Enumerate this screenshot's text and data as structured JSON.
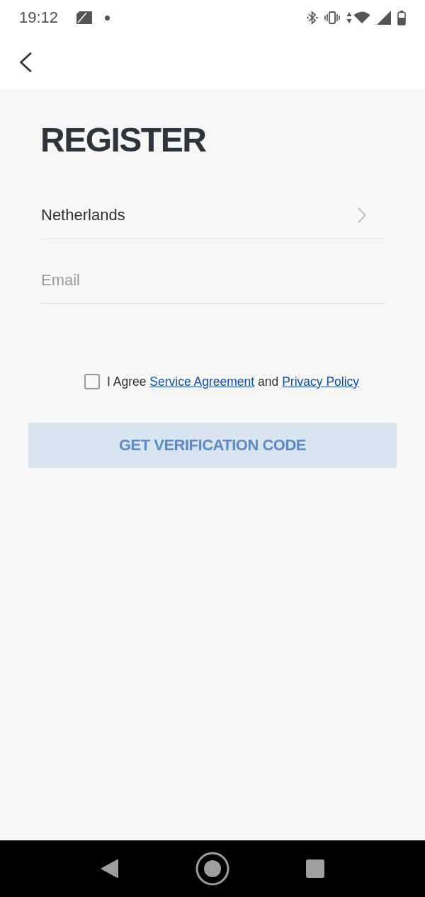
{
  "status_bar": {
    "time": "19:12"
  },
  "title": "REGISTER",
  "form": {
    "country": {
      "value": "Netherlands"
    },
    "email": {
      "placeholder": "Email"
    }
  },
  "agreement": {
    "checked": false,
    "parts": [
      {
        "kind": "text",
        "text": "I Agree"
      },
      {
        "kind": "link",
        "text": "Service Agreement"
      },
      {
        "kind": "text",
        "text": "and"
      },
      {
        "kind": "link",
        "text": "Privacy Policy"
      }
    ]
  },
  "submit_button": {
    "label": "GET VERIFICATION CODE",
    "disabled": true
  }
}
